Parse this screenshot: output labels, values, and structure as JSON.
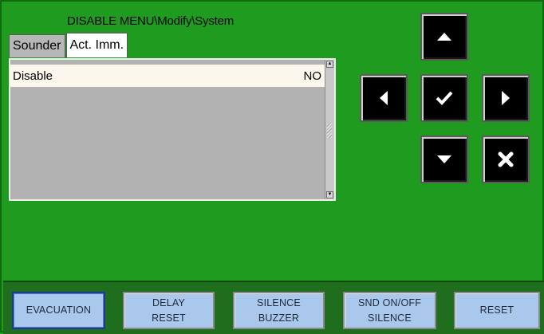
{
  "header": {
    "title": "DISABLE MENU\\Modify\\System"
  },
  "tabs": [
    {
      "label": "Sounder",
      "active": false
    },
    {
      "label": "Act. Imm.",
      "active": true
    }
  ],
  "list": {
    "rows": [
      {
        "label": "Disable",
        "value": "NO"
      }
    ]
  },
  "nav": {
    "up_icon": "arrow-up-icon",
    "left_icon": "arrow-left-icon",
    "confirm_icon": "checkmark-icon",
    "right_icon": "arrow-right-icon",
    "down_icon": "arrow-down-icon",
    "cancel_icon": "cross-icon"
  },
  "function_buttons": [
    {
      "line1": "EVACUATION",
      "line2": ""
    },
    {
      "line1": "DELAY",
      "line2": "RESET"
    },
    {
      "line1": "SILENCE",
      "line2": "BUZZER"
    },
    {
      "line1": "SND ON/OFF",
      "line2": "SILENCE"
    },
    {
      "line1": "RESET",
      "line2": ""
    }
  ],
  "colors": {
    "screen_bg": "#1f9c1f",
    "button_bg": "#a9c8ec",
    "nav_bg": "#000000"
  }
}
